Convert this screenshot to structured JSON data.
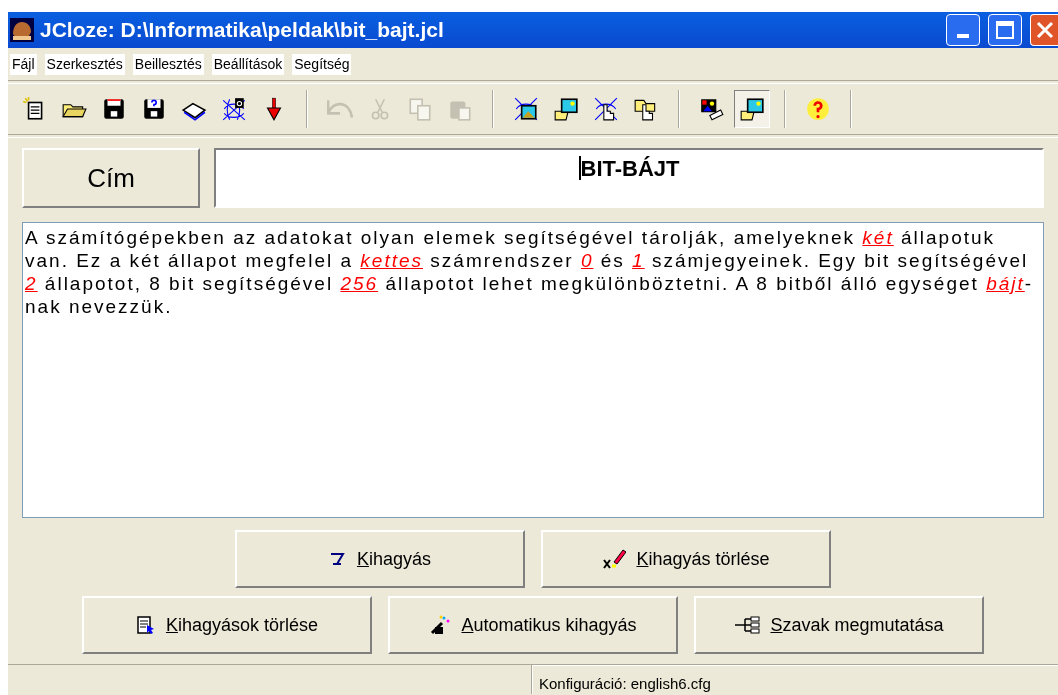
{
  "window": {
    "title": "JCloze: D:\\Informatika\\peldak\\bit_bajt.jcl"
  },
  "menu": [
    "Fájl",
    "Szerkesztés",
    "Beillesztés",
    "Beállítások",
    "Segítség"
  ],
  "toolbar": [
    [
      {
        "kind": "new",
        "disabled": false,
        "pressed": false
      },
      {
        "kind": "open",
        "disabled": false,
        "pressed": false
      },
      {
        "kind": "save",
        "disabled": false,
        "pressed": false
      },
      {
        "kind": "save-as",
        "disabled": false,
        "pressed": false
      },
      {
        "kind": "book",
        "disabled": false,
        "pressed": false
      },
      {
        "kind": "web",
        "disabled": false,
        "pressed": false
      },
      {
        "kind": "arrow",
        "disabled": false,
        "pressed": false
      }
    ],
    [
      {
        "kind": "undo",
        "disabled": true,
        "pressed": false
      },
      {
        "kind": "cut",
        "disabled": true,
        "pressed": false
      },
      {
        "kind": "copy",
        "disabled": true,
        "pressed": false
      },
      {
        "kind": "paste",
        "disabled": true,
        "pressed": false
      }
    ],
    [
      {
        "kind": "image-net",
        "disabled": false,
        "pressed": false
      },
      {
        "kind": "image-folder",
        "disabled": false,
        "pressed": false
      },
      {
        "kind": "hand-net",
        "disabled": false,
        "pressed": false
      },
      {
        "kind": "hand-folder",
        "disabled": false,
        "pressed": false
      }
    ],
    [
      {
        "kind": "image-tag",
        "disabled": false,
        "pressed": false
      },
      {
        "kind": "image-folder",
        "disabled": false,
        "pressed": true
      }
    ],
    [
      {
        "kind": "help",
        "disabled": false,
        "pressed": false
      }
    ]
  ],
  "title_label": "Cím",
  "title_value": "BIT-BÁJT",
  "text": [
    {
      "kind": "plain",
      "text": "A számítógépekben az adatokat olyan elemek segítségével tárolják, amelyeknek "
    },
    {
      "kind": "gap",
      "text": "két"
    },
    {
      "kind": "plain",
      "text": " állapotuk van. Ez a két állapot megfelel a "
    },
    {
      "kind": "gap",
      "text": "kettes"
    },
    {
      "kind": "plain",
      "text": " számrendszer "
    },
    {
      "kind": "gap",
      "text": "0"
    },
    {
      "kind": "plain",
      "text": " és "
    },
    {
      "kind": "gap",
      "text": "1"
    },
    {
      "kind": "plain",
      "text": " számjegyeinek. Egy bit segítségével "
    },
    {
      "kind": "gap",
      "text": "2"
    },
    {
      "kind": "plain",
      "text": " állapotot, 8 bit segítségével "
    },
    {
      "kind": "gap",
      "text": "256"
    },
    {
      "kind": "plain",
      "text": " állapotot lehet megkülönböztetni. A 8 bitből álló egységet "
    },
    {
      "kind": "gap",
      "text": "bájt"
    },
    {
      "kind": "plain",
      "text": "-nak nevezzük."
    }
  ],
  "buttons": [
    [
      {
        "kind": "gap",
        "accel": "K",
        "rest": "ihagyás"
      },
      {
        "kind": "erase",
        "accel": "K",
        "rest": "ihagyás törlése"
      }
    ],
    [
      {
        "kind": "clear",
        "accel": "K",
        "rest": "ihagyások törlése"
      },
      {
        "kind": "auto",
        "accel": "A",
        "rest": "utomatikus kihagyás"
      },
      {
        "kind": "words",
        "accel": "S",
        "rest": "zavak megmutatása"
      }
    ]
  ],
  "status_bar": [
    "Konfiguráció: english6.cfg"
  ]
}
